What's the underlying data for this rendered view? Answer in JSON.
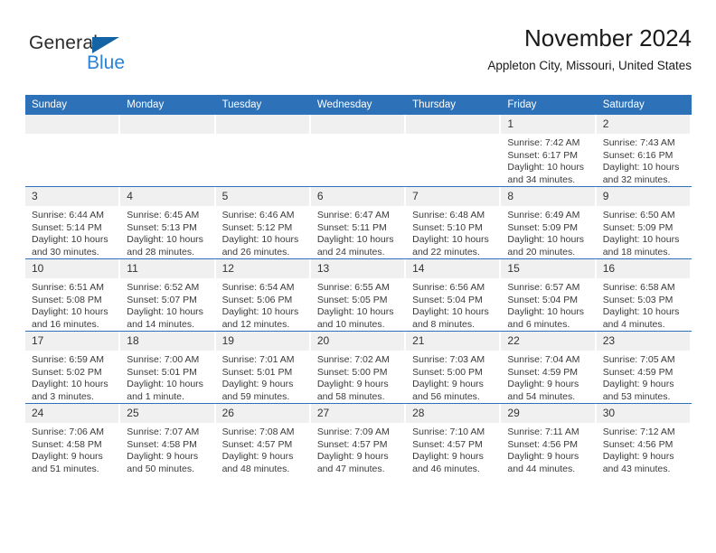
{
  "brand": {
    "name_part1": "General",
    "name_part2": "Blue",
    "triangle_color": "#1464a5",
    "blue_color": "#2a83d4"
  },
  "header": {
    "title": "November 2024",
    "subtitle": "Appleton City, Missouri, United States"
  },
  "theme": {
    "header_bg": "#2d72b8",
    "daynum_bg": "#f0f0f0",
    "row_rule": "#2d72b8",
    "text": "#3a3a3a"
  },
  "weekdays": [
    "Sunday",
    "Monday",
    "Tuesday",
    "Wednesday",
    "Thursday",
    "Friday",
    "Saturday"
  ],
  "weeks": [
    [
      {
        "day": "",
        "sunrise": "",
        "sunset": "",
        "daylight1": "",
        "daylight2": "",
        "empty": true
      },
      {
        "day": "",
        "sunrise": "",
        "sunset": "",
        "daylight1": "",
        "daylight2": "",
        "empty": true
      },
      {
        "day": "",
        "sunrise": "",
        "sunset": "",
        "daylight1": "",
        "daylight2": "",
        "empty": true
      },
      {
        "day": "",
        "sunrise": "",
        "sunset": "",
        "daylight1": "",
        "daylight2": "",
        "empty": true
      },
      {
        "day": "",
        "sunrise": "",
        "sunset": "",
        "daylight1": "",
        "daylight2": "",
        "empty": true
      },
      {
        "day": "1",
        "sunrise": "Sunrise: 7:42 AM",
        "sunset": "Sunset: 6:17 PM",
        "daylight1": "Daylight: 10 hours",
        "daylight2": "and 34 minutes.",
        "empty": false
      },
      {
        "day": "2",
        "sunrise": "Sunrise: 7:43 AM",
        "sunset": "Sunset: 6:16 PM",
        "daylight1": "Daylight: 10 hours",
        "daylight2": "and 32 minutes.",
        "empty": false
      }
    ],
    [
      {
        "day": "3",
        "sunrise": "Sunrise: 6:44 AM",
        "sunset": "Sunset: 5:14 PM",
        "daylight1": "Daylight: 10 hours",
        "daylight2": "and 30 minutes.",
        "empty": false
      },
      {
        "day": "4",
        "sunrise": "Sunrise: 6:45 AM",
        "sunset": "Sunset: 5:13 PM",
        "daylight1": "Daylight: 10 hours",
        "daylight2": "and 28 minutes.",
        "empty": false
      },
      {
        "day": "5",
        "sunrise": "Sunrise: 6:46 AM",
        "sunset": "Sunset: 5:12 PM",
        "daylight1": "Daylight: 10 hours",
        "daylight2": "and 26 minutes.",
        "empty": false
      },
      {
        "day": "6",
        "sunrise": "Sunrise: 6:47 AM",
        "sunset": "Sunset: 5:11 PM",
        "daylight1": "Daylight: 10 hours",
        "daylight2": "and 24 minutes.",
        "empty": false
      },
      {
        "day": "7",
        "sunrise": "Sunrise: 6:48 AM",
        "sunset": "Sunset: 5:10 PM",
        "daylight1": "Daylight: 10 hours",
        "daylight2": "and 22 minutes.",
        "empty": false
      },
      {
        "day": "8",
        "sunrise": "Sunrise: 6:49 AM",
        "sunset": "Sunset: 5:09 PM",
        "daylight1": "Daylight: 10 hours",
        "daylight2": "and 20 minutes.",
        "empty": false
      },
      {
        "day": "9",
        "sunrise": "Sunrise: 6:50 AM",
        "sunset": "Sunset: 5:09 PM",
        "daylight1": "Daylight: 10 hours",
        "daylight2": "and 18 minutes.",
        "empty": false
      }
    ],
    [
      {
        "day": "10",
        "sunrise": "Sunrise: 6:51 AM",
        "sunset": "Sunset: 5:08 PM",
        "daylight1": "Daylight: 10 hours",
        "daylight2": "and 16 minutes.",
        "empty": false
      },
      {
        "day": "11",
        "sunrise": "Sunrise: 6:52 AM",
        "sunset": "Sunset: 5:07 PM",
        "daylight1": "Daylight: 10 hours",
        "daylight2": "and 14 minutes.",
        "empty": false
      },
      {
        "day": "12",
        "sunrise": "Sunrise: 6:54 AM",
        "sunset": "Sunset: 5:06 PM",
        "daylight1": "Daylight: 10 hours",
        "daylight2": "and 12 minutes.",
        "empty": false
      },
      {
        "day": "13",
        "sunrise": "Sunrise: 6:55 AM",
        "sunset": "Sunset: 5:05 PM",
        "daylight1": "Daylight: 10 hours",
        "daylight2": "and 10 minutes.",
        "empty": false
      },
      {
        "day": "14",
        "sunrise": "Sunrise: 6:56 AM",
        "sunset": "Sunset: 5:04 PM",
        "daylight1": "Daylight: 10 hours",
        "daylight2": "and 8 minutes.",
        "empty": false
      },
      {
        "day": "15",
        "sunrise": "Sunrise: 6:57 AM",
        "sunset": "Sunset: 5:04 PM",
        "daylight1": "Daylight: 10 hours",
        "daylight2": "and 6 minutes.",
        "empty": false
      },
      {
        "day": "16",
        "sunrise": "Sunrise: 6:58 AM",
        "sunset": "Sunset: 5:03 PM",
        "daylight1": "Daylight: 10 hours",
        "daylight2": "and 4 minutes.",
        "empty": false
      }
    ],
    [
      {
        "day": "17",
        "sunrise": "Sunrise: 6:59 AM",
        "sunset": "Sunset: 5:02 PM",
        "daylight1": "Daylight: 10 hours",
        "daylight2": "and 3 minutes.",
        "empty": false
      },
      {
        "day": "18",
        "sunrise": "Sunrise: 7:00 AM",
        "sunset": "Sunset: 5:01 PM",
        "daylight1": "Daylight: 10 hours",
        "daylight2": "and 1 minute.",
        "empty": false
      },
      {
        "day": "19",
        "sunrise": "Sunrise: 7:01 AM",
        "sunset": "Sunset: 5:01 PM",
        "daylight1": "Daylight: 9 hours",
        "daylight2": "and 59 minutes.",
        "empty": false
      },
      {
        "day": "20",
        "sunrise": "Sunrise: 7:02 AM",
        "sunset": "Sunset: 5:00 PM",
        "daylight1": "Daylight: 9 hours",
        "daylight2": "and 58 minutes.",
        "empty": false
      },
      {
        "day": "21",
        "sunrise": "Sunrise: 7:03 AM",
        "sunset": "Sunset: 5:00 PM",
        "daylight1": "Daylight: 9 hours",
        "daylight2": "and 56 minutes.",
        "empty": false
      },
      {
        "day": "22",
        "sunrise": "Sunrise: 7:04 AM",
        "sunset": "Sunset: 4:59 PM",
        "daylight1": "Daylight: 9 hours",
        "daylight2": "and 54 minutes.",
        "empty": false
      },
      {
        "day": "23",
        "sunrise": "Sunrise: 7:05 AM",
        "sunset": "Sunset: 4:59 PM",
        "daylight1": "Daylight: 9 hours",
        "daylight2": "and 53 minutes.",
        "empty": false
      }
    ],
    [
      {
        "day": "24",
        "sunrise": "Sunrise: 7:06 AM",
        "sunset": "Sunset: 4:58 PM",
        "daylight1": "Daylight: 9 hours",
        "daylight2": "and 51 minutes.",
        "empty": false
      },
      {
        "day": "25",
        "sunrise": "Sunrise: 7:07 AM",
        "sunset": "Sunset: 4:58 PM",
        "daylight1": "Daylight: 9 hours",
        "daylight2": "and 50 minutes.",
        "empty": false
      },
      {
        "day": "26",
        "sunrise": "Sunrise: 7:08 AM",
        "sunset": "Sunset: 4:57 PM",
        "daylight1": "Daylight: 9 hours",
        "daylight2": "and 48 minutes.",
        "empty": false
      },
      {
        "day": "27",
        "sunrise": "Sunrise: 7:09 AM",
        "sunset": "Sunset: 4:57 PM",
        "daylight1": "Daylight: 9 hours",
        "daylight2": "and 47 minutes.",
        "empty": false
      },
      {
        "day": "28",
        "sunrise": "Sunrise: 7:10 AM",
        "sunset": "Sunset: 4:57 PM",
        "daylight1": "Daylight: 9 hours",
        "daylight2": "and 46 minutes.",
        "empty": false
      },
      {
        "day": "29",
        "sunrise": "Sunrise: 7:11 AM",
        "sunset": "Sunset: 4:56 PM",
        "daylight1": "Daylight: 9 hours",
        "daylight2": "and 44 minutes.",
        "empty": false
      },
      {
        "day": "30",
        "sunrise": "Sunrise: 7:12 AM",
        "sunset": "Sunset: 4:56 PM",
        "daylight1": "Daylight: 9 hours",
        "daylight2": "and 43 minutes.",
        "empty": false
      }
    ]
  ]
}
